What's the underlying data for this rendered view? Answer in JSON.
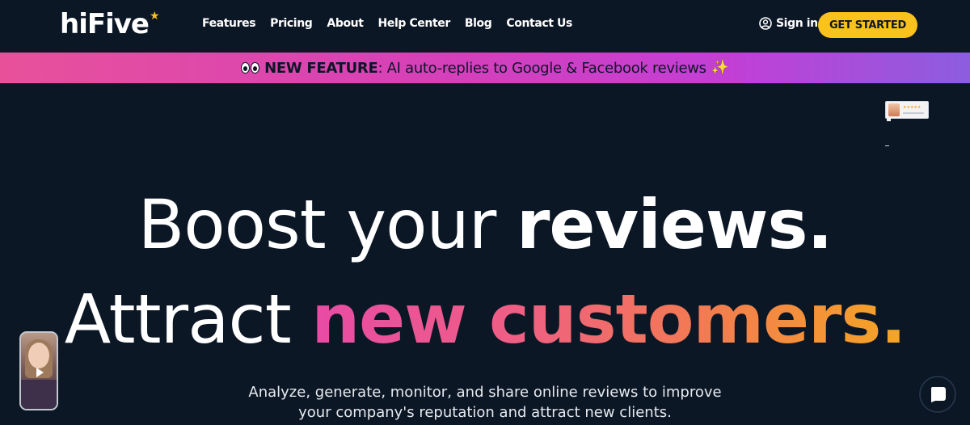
{
  "brand": {
    "logo_text": "hiFive",
    "star": "★"
  },
  "nav": {
    "links": [
      "Features",
      "Pricing",
      "About",
      "Help Center",
      "Blog",
      "Contact Us"
    ]
  },
  "header": {
    "signin_label": "Sign in",
    "cta_label": "GET STARTED"
  },
  "banner": {
    "strong": "NEW FEATURE",
    "text": ": AI auto-replies to Google & Facebook reviews",
    "sparkle": "✨"
  },
  "hero": {
    "line1_light": "Boost your ",
    "line1_bold": "reviews.",
    "line2_light": "Attract ",
    "line2_pink": "new",
    "line2_orange": "customers."
  },
  "subtitle": {
    "line1": "Analyze, generate, monitor, and share online reviews to improve",
    "line2": "your company's reputation and attract new clients."
  },
  "colors": {
    "background": "#0c1726",
    "accent_yellow": "#f9c21c",
    "banner_pink": "#e8519a",
    "banner_purple": "#8c5ddf"
  },
  "icons": {
    "user": "user-circle-icon",
    "eyes": "eyes-icon",
    "sparkle": "sparkle-icon",
    "play": "play-icon",
    "chat": "chat-icon"
  }
}
